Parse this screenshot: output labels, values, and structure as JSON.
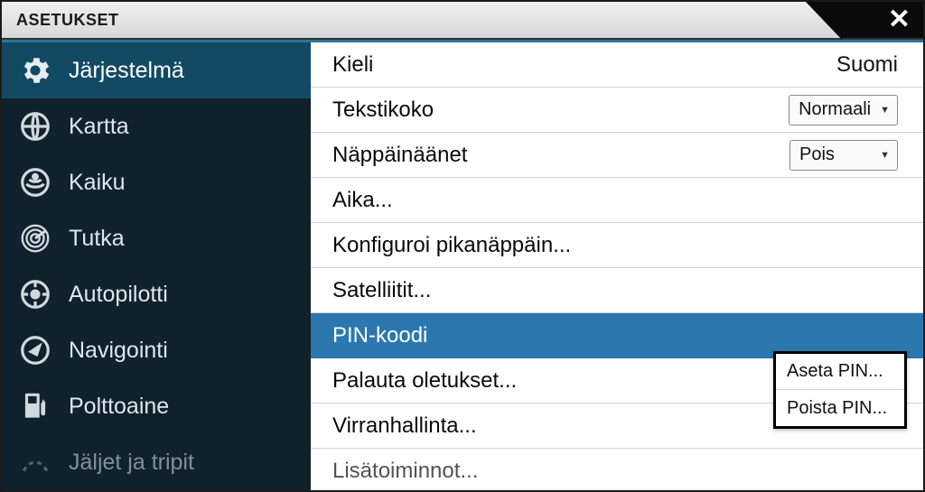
{
  "title": "ASETUKSET",
  "sidebar": {
    "items": [
      {
        "label": "Järjestelmä"
      },
      {
        "label": "Kartta"
      },
      {
        "label": "Kaiku"
      },
      {
        "label": "Tutka"
      },
      {
        "label": "Autopilotti"
      },
      {
        "label": "Navigointi"
      },
      {
        "label": "Polttoaine"
      },
      {
        "label": "Jäljet ja tripit"
      }
    ]
  },
  "main": {
    "rows": [
      {
        "label": "Kieli",
        "value": "Suomi"
      },
      {
        "label": "Tekstikoko",
        "value": "Normaali"
      },
      {
        "label": "Näppäinäänet",
        "value": "Pois"
      },
      {
        "label": "Aika..."
      },
      {
        "label": "Konfiguroi pikanäppäin..."
      },
      {
        "label": "Satelliitit..."
      },
      {
        "label": "PIN-koodi"
      },
      {
        "label": "Palauta oletukset..."
      },
      {
        "label": "Virranhallinta..."
      },
      {
        "label": "Lisätoiminnot..."
      }
    ]
  },
  "popup": {
    "items": [
      {
        "label": "Aseta PIN..."
      },
      {
        "label": "Poista PIN..."
      }
    ]
  }
}
